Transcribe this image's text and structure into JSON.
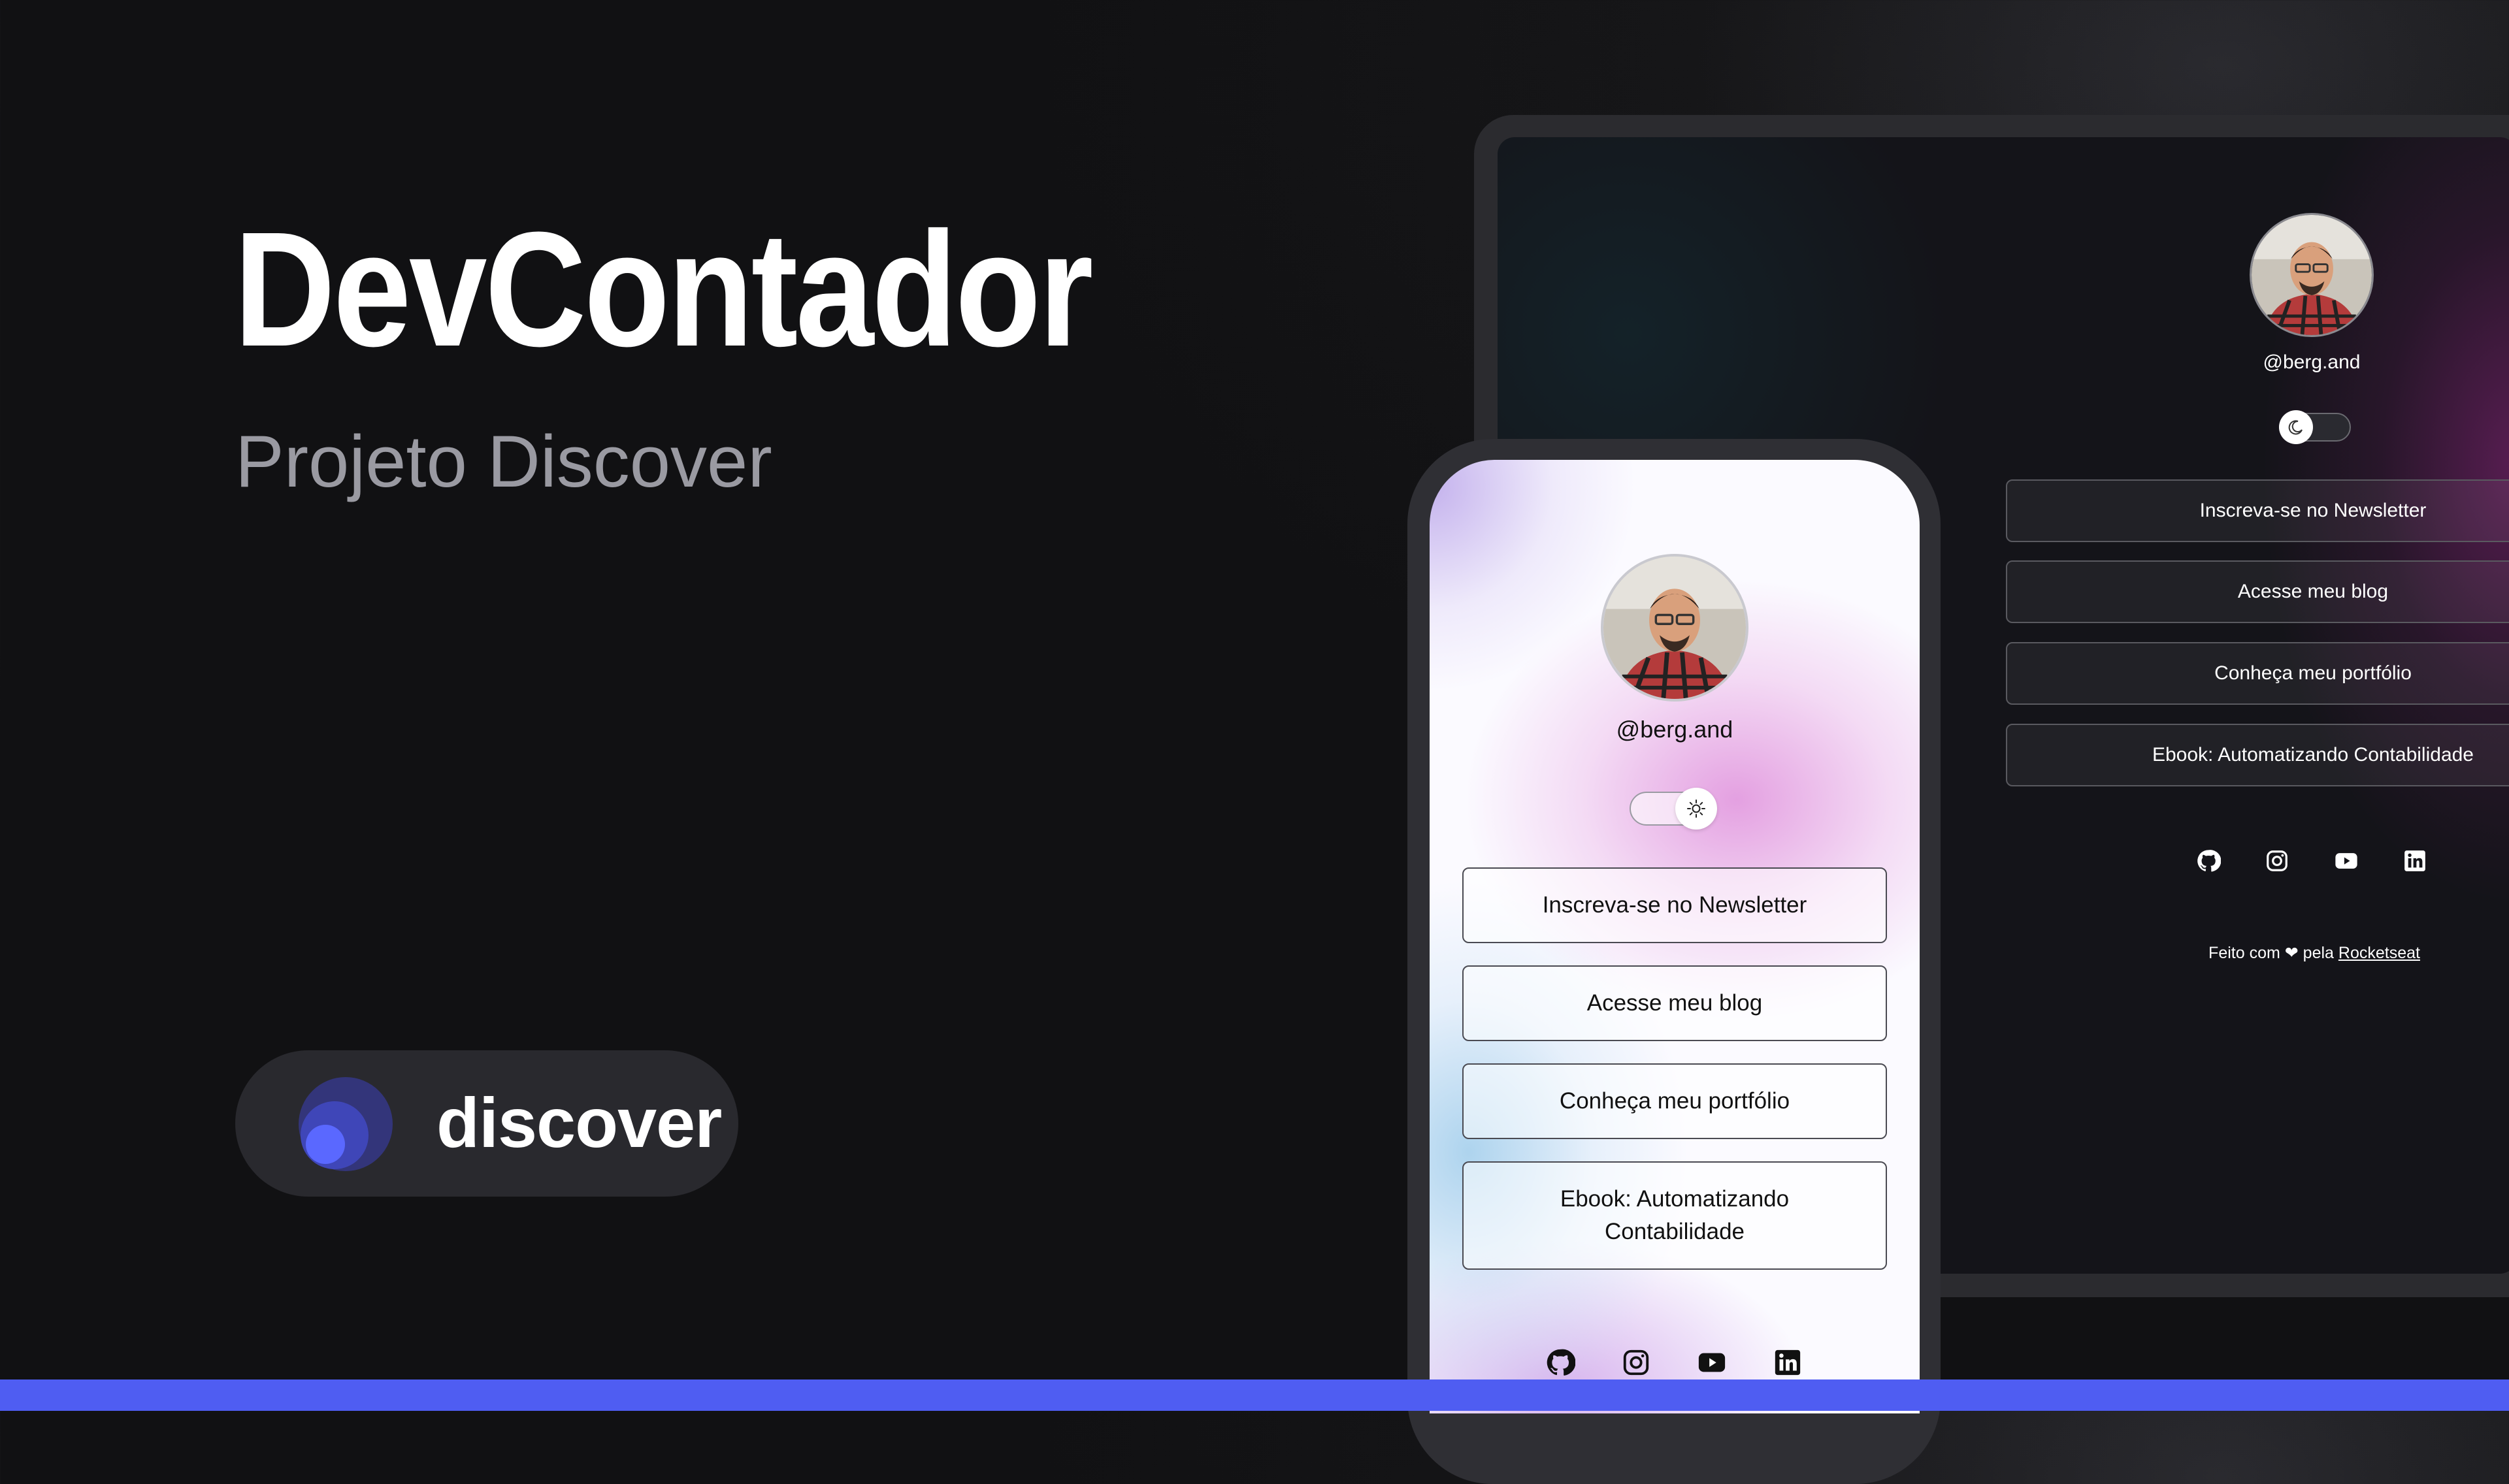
{
  "hero": {
    "title": "DevContador",
    "subtitle": "Projeto Discover",
    "badge_label": "discover"
  },
  "profile": {
    "handle": "@berg.and"
  },
  "links": [
    {
      "label": "Inscreva-se no Newsletter"
    },
    {
      "label": "Acesse meu blog"
    },
    {
      "label": "Conheça meu portfólio"
    },
    {
      "label": "Ebook: Automatizando Contabilidade"
    }
  ],
  "socials": [
    "github-icon",
    "instagram-icon",
    "youtube-icon",
    "linkedin-icon"
  ],
  "footer": {
    "prefix": "Feito com",
    "middle": "pela",
    "link": "Rocketseat"
  },
  "theme_toggle": {
    "laptop_mode": "dark",
    "phone_mode": "light"
  },
  "colors": {
    "accent": "#4f5df2",
    "background": "#111113",
    "badge_bg": "#29292e"
  }
}
